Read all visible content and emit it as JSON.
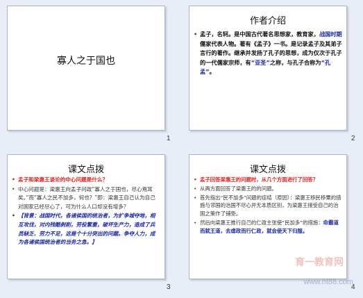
{
  "slides": [
    {
      "number": "1",
      "title": "寡人之于国也"
    },
    {
      "number": "2",
      "heading": "作者介绍",
      "text_a": "孟子，名轲。是中国古代著名思想家，教育家，",
      "text_b": "战国时期",
      "text_c": "儒家代表人物。著有《孟子》一书。是记录孟子及其弟子言行的著作。继承并发扬了孔子的思想，成为仅次于孔子的一代儒家宗师，有",
      "text_d": "“亚圣”",
      "text_e": "之称，与孔子合称为",
      "text_f": "“孔孟”",
      "text_g": "。"
    },
    {
      "number": "3",
      "heading": "课文点拨",
      "q": "孟子和梁惠王谈论的中心问题是什么？",
      "p1": "中心问题是：梁惠王向孟子问政“寡人之于国也，尽心焉耳矣。”而“寡人之民不加多，何也？”即：梁惠王自己认为自己对国家已经尽心了，可为什么人口却没有增多？",
      "bg": "【背景：战国时代，各诸侯国的统治者，为扩争城夺地，相互攻伐，对内残酷剥削，劳役繁重，破坏生产力，造成了兵员缺乏、劳力不足，这是个十分突出的问题。争夺人力，成为各诸侯国统治者的当务之急。】"
    },
    {
      "number": "4",
      "heading": "课文点拨",
      "q": "孟子回答梁惠王的问题时，从几个方面进行了回答？",
      "p1": "从两方面回答了梁惠王的的问题。",
      "p2": "首先指出“民不加多”问题的症结（原因）：梁惠王移民移粟的措施与邻国的治国不尽心并无本质区别，为梁惠王接受自己的治国之策作了铺垫。",
      "p3a": "然后向梁惠王推行自己的仁政主张使“民加多”的措施：",
      "p3b": "命霸道而就王道，去虐政而行仁政，就会使天下归服。",
      "watermark": "育一教育网",
      "watermark_url": "www.ht88.com"
    }
  ]
}
